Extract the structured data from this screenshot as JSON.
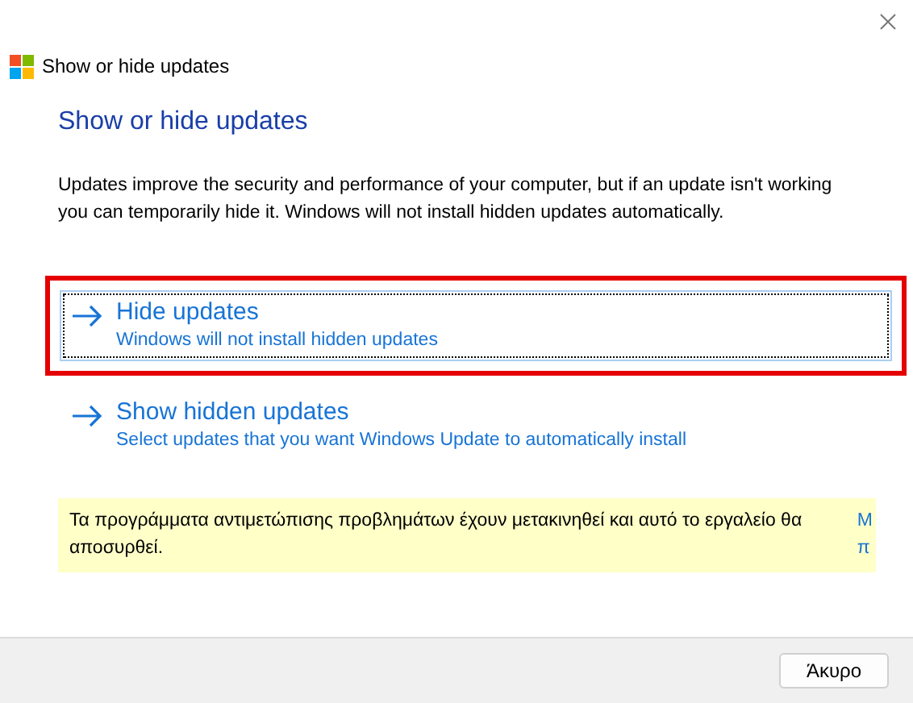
{
  "window": {
    "title": "Show or hide updates"
  },
  "heading": "Show or hide updates",
  "description": "Updates improve the security and performance of your computer, but if an update isn't working you can temporarily hide it. Windows will not install hidden updates automatically.",
  "options": [
    {
      "title": "Hide updates",
      "subtitle": "Windows will not install hidden updates",
      "focused": true,
      "highlighted": true
    },
    {
      "title": "Show hidden updates",
      "subtitle": "Select updates that you want Windows Update to automatically install",
      "focused": false,
      "highlighted": false
    }
  ],
  "notice": {
    "lines": [
      "Τα προγράμματα αντιμετώπισης προβλημάτων έχουν μετακινηθεί και αυτό το εργαλείο θα",
      "αποσυρθεί."
    ],
    "link_lines": [
      "Μ",
      "π"
    ]
  },
  "buttons": [
    "Άκυρο"
  ]
}
